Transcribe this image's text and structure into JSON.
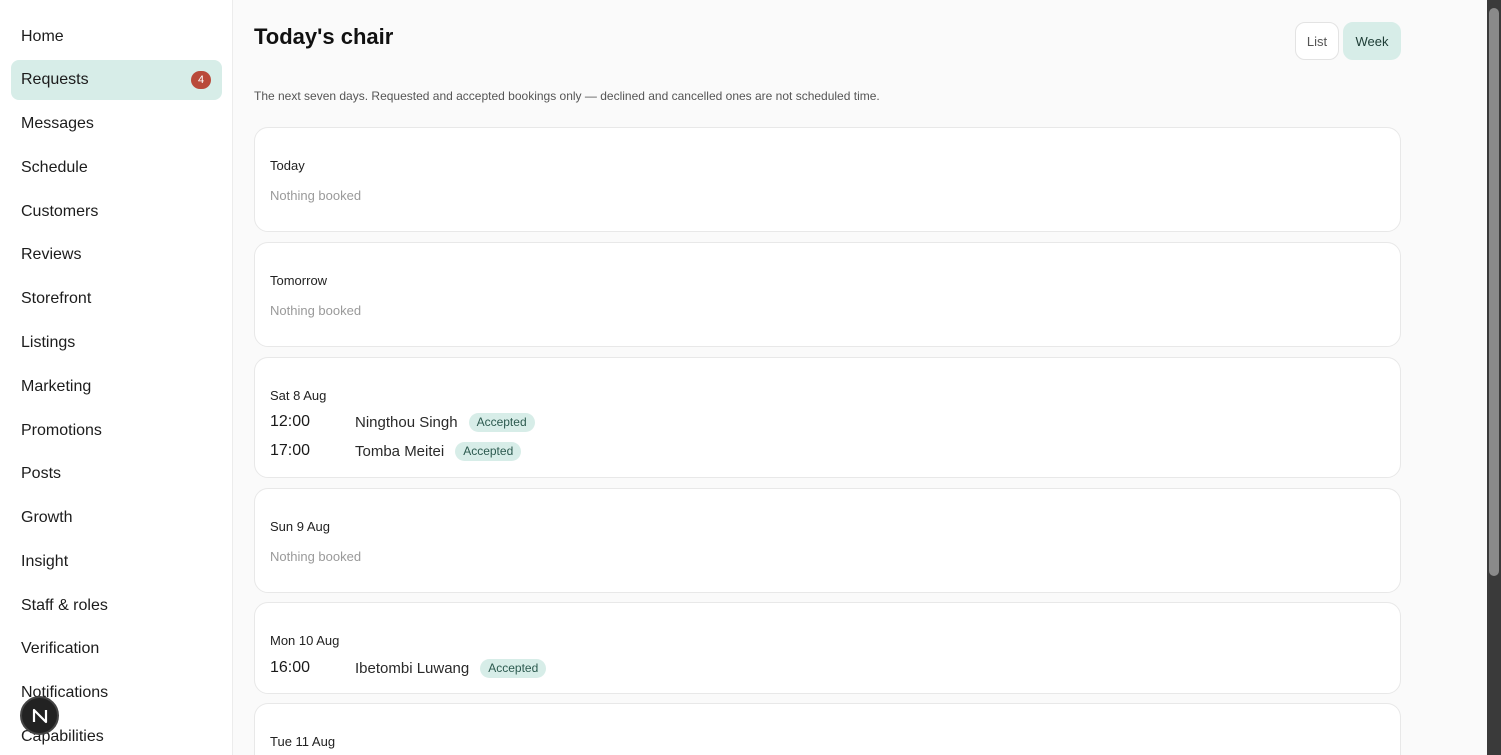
{
  "sidebar": {
    "items": [
      {
        "label": "Home"
      },
      {
        "label": "Requests",
        "badge": "4"
      },
      {
        "label": "Messages"
      },
      {
        "label": "Schedule"
      },
      {
        "label": "Customers"
      },
      {
        "label": "Reviews"
      },
      {
        "label": "Storefront"
      },
      {
        "label": "Listings"
      },
      {
        "label": "Marketing"
      },
      {
        "label": "Promotions"
      },
      {
        "label": "Posts"
      },
      {
        "label": "Growth"
      },
      {
        "label": "Insight"
      },
      {
        "label": "Staff & roles"
      },
      {
        "label": "Verification"
      },
      {
        "label": "Notifications"
      },
      {
        "label": "Capabilities"
      }
    ],
    "active_item": "Requests",
    "fab_letter": "N"
  },
  "header": {
    "title": "Today's chair",
    "view_options": [
      "List",
      "Week"
    ],
    "selected_view": "Week"
  },
  "subtitle": "The next seven days. Requested and accepted bookings only — declined and cancelled ones are not scheduled time.",
  "empty_label": "Nothing booked",
  "days": [
    {
      "label": "Today",
      "bookings": []
    },
    {
      "label": "Tomorrow",
      "bookings": []
    },
    {
      "label": "Sat 8 Aug",
      "bookings": [
        {
          "time": "12:00",
          "name": "Ningthou Singh",
          "status": "Accepted"
        },
        {
          "time": "17:00",
          "name": "Tomba Meitei",
          "status": "Accepted"
        }
      ]
    },
    {
      "label": "Sun 9 Aug",
      "bookings": []
    },
    {
      "label": "Mon 10 Aug",
      "bookings": [
        {
          "time": "16:00",
          "name": "Ibetombi Luwang",
          "status": "Accepted"
        }
      ]
    },
    {
      "label": "Tue 11 Aug",
      "bookings": []
    }
  ],
  "colors": {
    "accent_bg": "#d7ede8",
    "badge_red": "#b94a3a",
    "accepted_text": "#2c5a4f"
  },
  "icons": {
    "fab": "n-logo-icon"
  }
}
